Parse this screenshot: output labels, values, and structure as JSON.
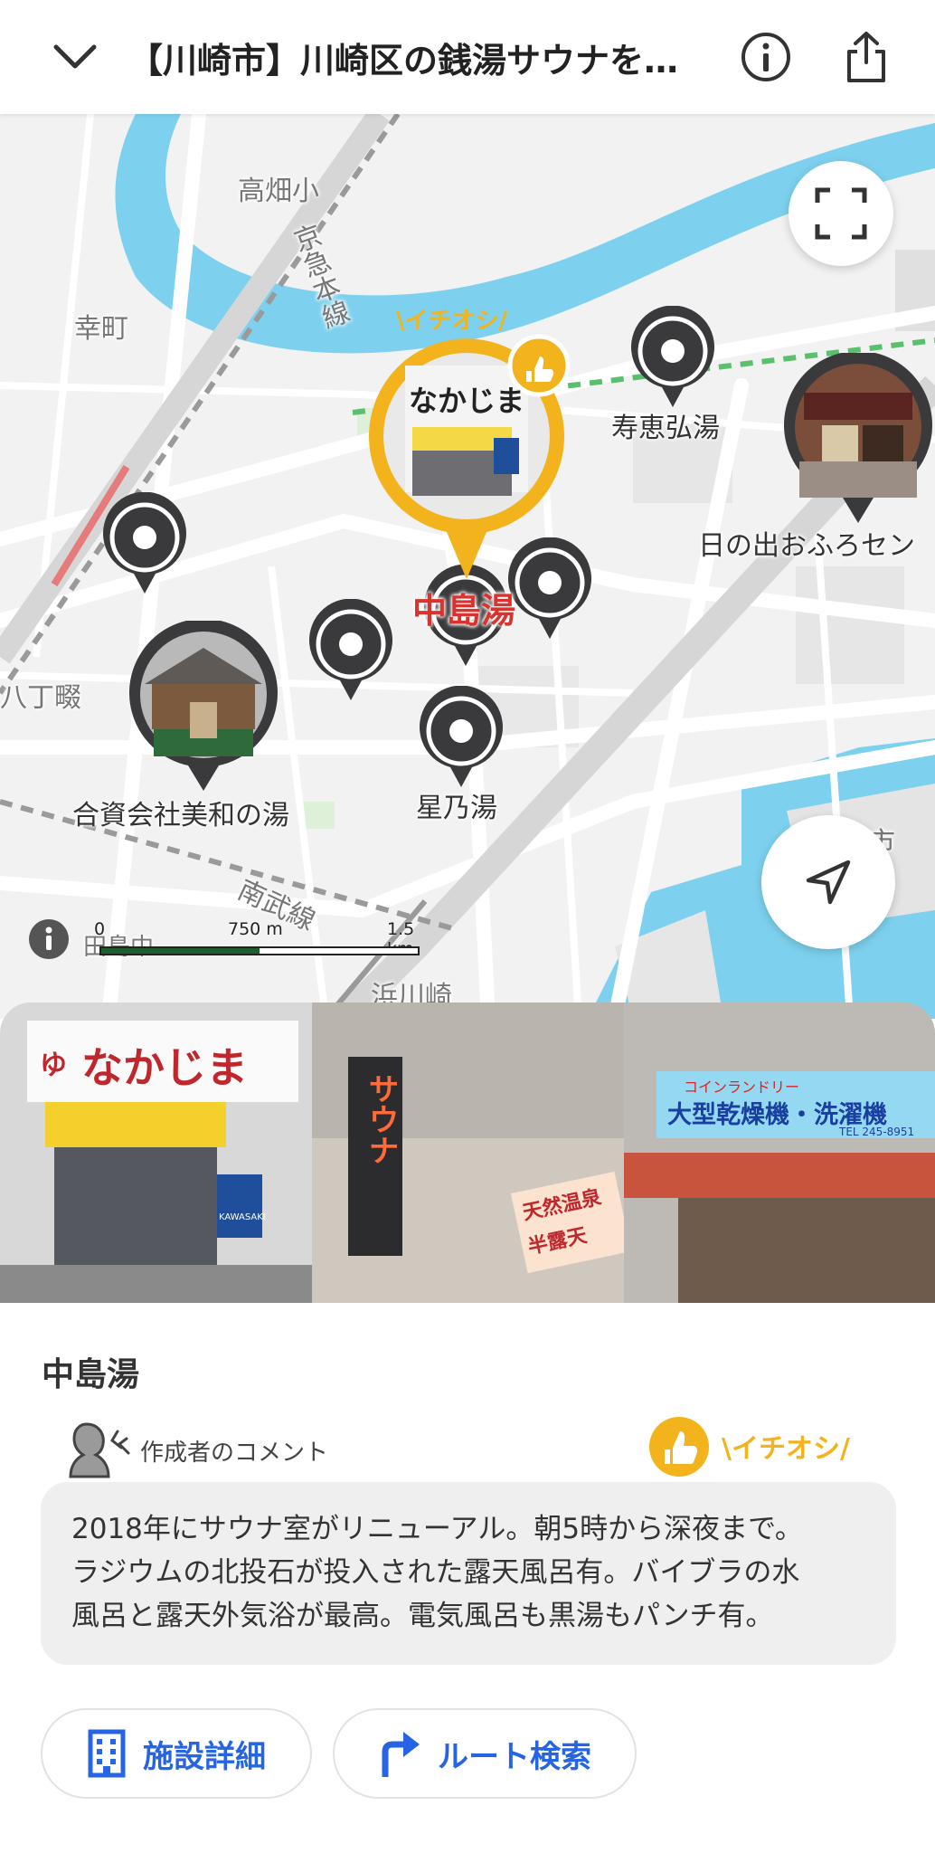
{
  "header": {
    "title": "【川崎市】川崎区の銭湯サウナを…",
    "back_icon": "chevron-down-icon",
    "info_icon": "info-icon",
    "share_icon": "share-icon"
  },
  "map": {
    "labels": {
      "takahata": "高畑小",
      "keikyu": "京急本線",
      "saiwaicho": "幸町",
      "kotobuki": "寿恵弘湯",
      "hinode": "日の出おふろセン",
      "nakajima": "中島湯",
      "miwa": "合資会社美和の湯",
      "hoshino": "星乃湯",
      "nambu": "南武線",
      "hacchonawate": "八丁畷",
      "shi": "市",
      "kawasakishin": "浜川崎",
      "tajima": "田島中"
    },
    "featured_tag": "\\イチオシ/",
    "scale": {
      "zero": "0",
      "mid": "750 m",
      "max": "1.5 km"
    },
    "colors": {
      "water": "#7dd1ee",
      "pin": "#3a3a3c",
      "featured": "#f2b31c",
      "selected_label": "#d9322f"
    }
  },
  "place": {
    "name": "中島湯",
    "comment_label": "作成者のコメント",
    "ichioshi": "\\イチオシ/",
    "comment_lines": [
      "2018年にサウナ室がリニューアル。朝5時から深夜まで。",
      "ラジウムの北投石が投入された露天風呂有。バイブラの水",
      "風呂と露天外気浴が最高。電気風呂も黒湯もパンチ有。"
    ]
  },
  "gallery": {
    "photo1_sign": "なかじま",
    "photo1_logo": "ゆ",
    "photo1_badge": "KAWASAKI",
    "photo2_sign": "サウナ",
    "photo2_tag1": "天然温泉",
    "photo2_tag2": "半露天",
    "photo3_sub": "コインランドリー",
    "photo3_main": "大型乾燥機・洗濯機",
    "photo3_tel": "TEL 245-8951"
  },
  "actions": {
    "detail_label": "施設詳細",
    "route_label": "ルート検索"
  }
}
